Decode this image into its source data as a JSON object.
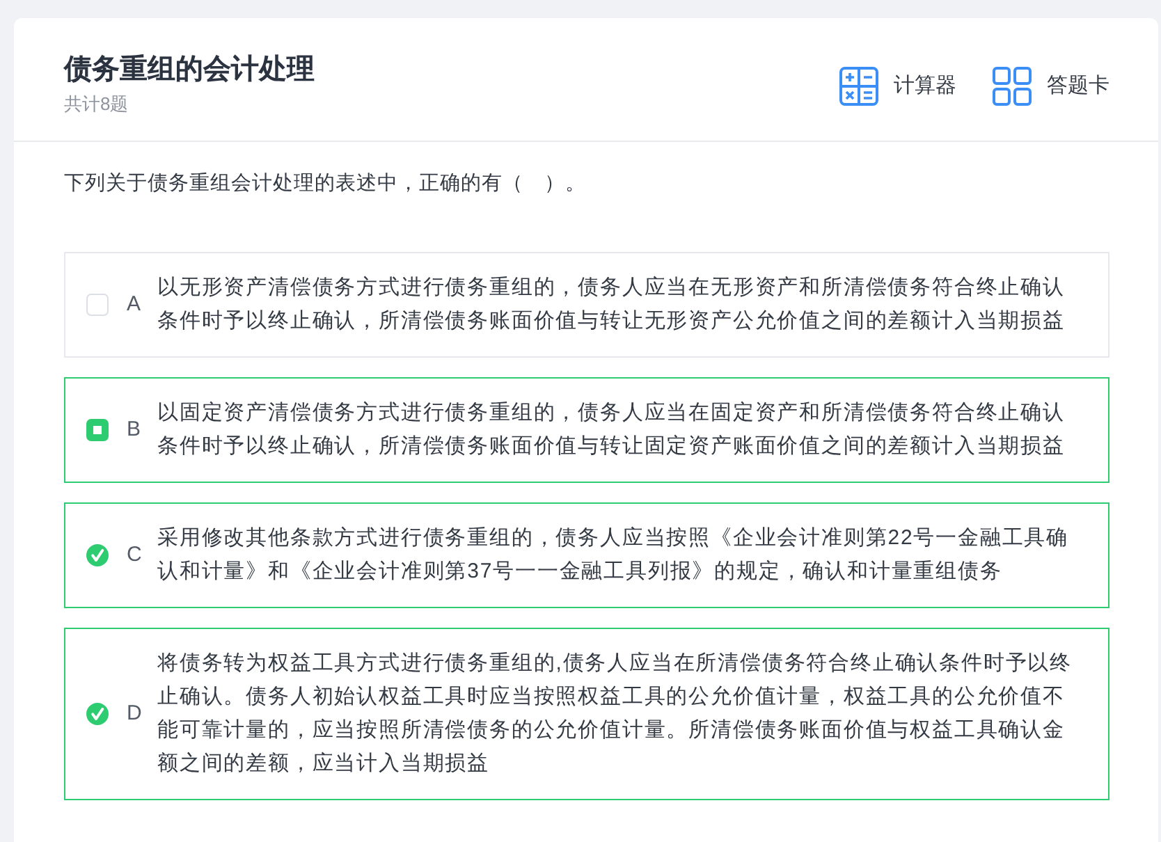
{
  "header": {
    "title": "债务重组的会计处理",
    "subtitle": "共计8题",
    "tools": [
      {
        "kind": "calculator",
        "label": "计算器"
      },
      {
        "kind": "answer_card",
        "label": "答题卡"
      }
    ]
  },
  "question": {
    "text": "下列关于债务重组会计处理的表述中，正确的有（　）。"
  },
  "options": [
    {
      "letter": "A",
      "text": "以无形资产清偿债务方式进行债务重组的，债务人应当在无形资产和所清偿债务符合终止确认条件时予以终止确认，所清偿债务账面价值与转让无形资产公允价值之间的差额计入当期损益",
      "selected": false,
      "correct": false
    },
    {
      "letter": "B",
      "text": "以固定资产清偿债务方式进行债务重组的，债务人应当在固定资产和所清偿债务符合终止确认条件时予以终止确认，所清偿债务账面价值与转让固定资产账面价值之间的差额计入当期损益",
      "selected": true,
      "correct": false
    },
    {
      "letter": "C",
      "text": "采用修改其他条款方式进行债务重组的，债务人应当按照《企业会计准则第22号一金融工具确认和计量》和《企业会计准则第37号一一金融工具列报》的规定，确认和计量重组债务",
      "selected": true,
      "correct": true
    },
    {
      "letter": "D",
      "text": "将债务转为权益工具方式进行债务重组的,债务人应当在所清偿债务符合终止确认条件时予以终止确认。债务人初始认权益工具时应当按照权益工具的公允价值计量，权益工具的公允价值不能可靠计量的，应当按照所清偿债务的公允价值计量。所清偿债务账面价值与权益工具确认金额之间的差额，应当计入当期损益",
      "selected": true,
      "correct": true
    }
  ]
}
